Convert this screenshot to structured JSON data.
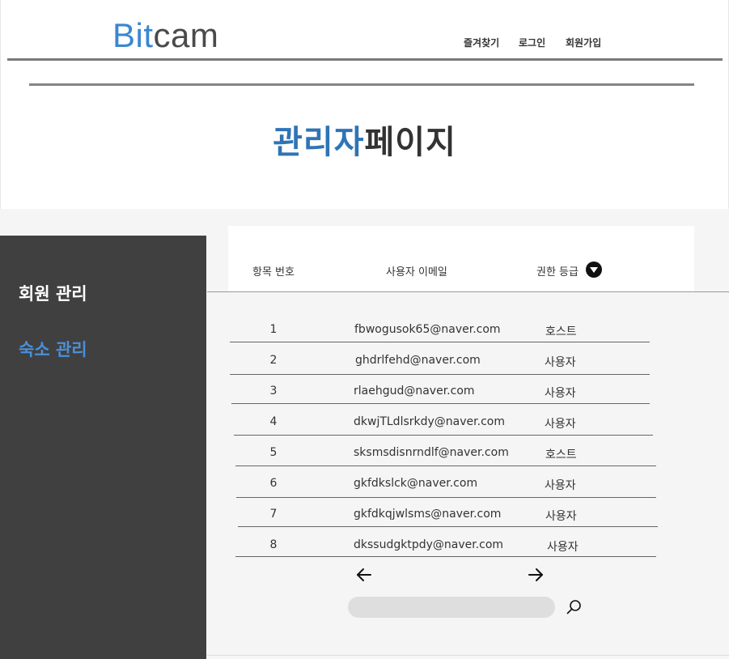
{
  "header": {
    "logo_part1": "Bit",
    "logo_part2": "cam",
    "nav": [
      "즐겨찾기",
      "로그인",
      "회원가입"
    ]
  },
  "page_title": {
    "highlight": "관리자",
    "rest": "페이지"
  },
  "sidebar": {
    "items": [
      "회원 관리",
      "숙소 관리"
    ],
    "active_color": "#4a90d9"
  },
  "table": {
    "headers": [
      "항목 번호",
      "사용자 이메일",
      "권한 등급"
    ],
    "rows": [
      {
        "no": "1",
        "email": "fbwogusok65@naver.com",
        "role": "호스트"
      },
      {
        "no": "2",
        "email": "ghdrlfehd@naver.com",
        "role": "사용자"
      },
      {
        "no": "3",
        "email": "rlaehgud@naver.com",
        "role": "사용자"
      },
      {
        "no": "4",
        "email": "dkwjTLdlsrkdy@naver.com",
        "role": "사용자"
      },
      {
        "no": "5",
        "email": "sksmsdisnrndlf@naver.com",
        "role": "호스트"
      },
      {
        "no": "6",
        "email": "gkfdkslck@naver.com",
        "role": "사용자"
      },
      {
        "no": "7",
        "email": "gkfdkqjwlsms@naver.com",
        "role": "사용자"
      },
      {
        "no": "8",
        "email": "dkssudgktpdy@naver.com",
        "role": "사용자"
      }
    ]
  },
  "pagination": {
    "prev_icon": "arrow-left-icon",
    "next_icon": "arrow-right-icon"
  },
  "search": {
    "placeholder": "",
    "icon": "search-icon"
  },
  "colors": {
    "accent": "#2f74b5",
    "sidebar_bg": "#404040"
  }
}
